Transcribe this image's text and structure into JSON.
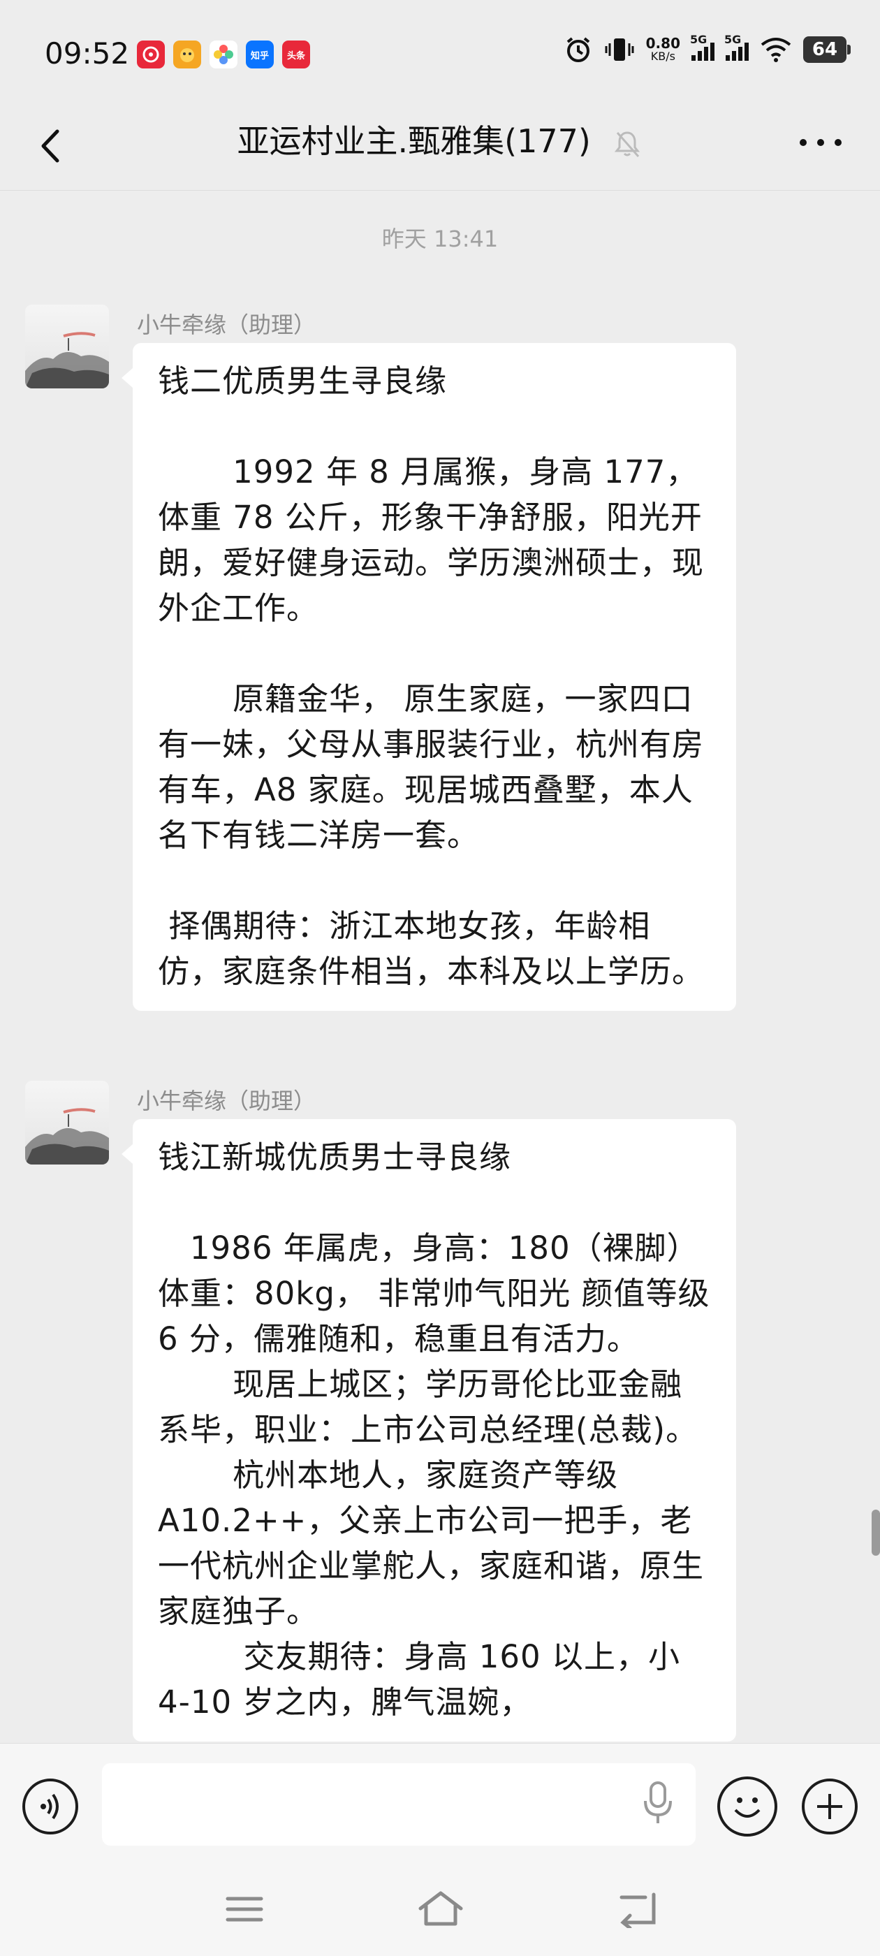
{
  "status_bar": {
    "time": "09:52",
    "app_icons": [
      {
        "name": "netease-music-icon",
        "text": "",
        "color": "#e8283a"
      },
      {
        "name": "kuaishou-icon",
        "text": "",
        "color": "#f5a623"
      },
      {
        "name": "photos-icon",
        "text": "",
        "color": "#ffffff"
      },
      {
        "name": "zhihu-icon",
        "text": "知乎",
        "color": "#0a74ff"
      },
      {
        "name": "toutiao-icon",
        "text": "头条",
        "color": "#e8283a"
      }
    ],
    "net_speed_value": "0.80",
    "net_speed_unit": "KB/s",
    "sim1": "5G",
    "sim2": "5G",
    "battery": "64"
  },
  "header": {
    "title": "亚运村业主.甄雅集(177)"
  },
  "chat": {
    "timestamp": "昨天 13:41",
    "messages": [
      {
        "sender": "小牛牵缘（助理）",
        "text": "钱二优质男生寻良缘\n\n       1992 年 8 月属猴，身高 177，体重 78 公斤，形象干净舒服，阳光开朗，爱好健身运动。学历澳洲硕士，现外企工作。\n\n       原籍金华， 原生家庭，一家四口有一妹，父母从事服装行业，杭州有房有车，A8 家庭。现居城西叠墅，本人名下有钱二洋房一套。\n\n 择偶期待：浙江本地女孩，年龄相仿，家庭条件相当，本科及以上学历。"
      },
      {
        "sender": "小牛牵缘（助理）",
        "text": "钱江新城优质男士寻良缘\n\n   1986 年属虎，身高：180（裸脚）体重：80kg， 非常帅气阳光 颜值等级 6 分，儒雅随和，稳重且有活力。\n       现居上城区；学历哥伦比亚金融系毕，职业：上市公司总经理(总裁)。\n       杭州本地人，家庭资产等级 A10.2++，父亲上市公司一把手，老一代杭州企业掌舵人，家庭和谐，原生家庭独子。\n        交友期待：身高 160 以上，小 4-10 岁之内，脾气温婉，"
      }
    ]
  }
}
